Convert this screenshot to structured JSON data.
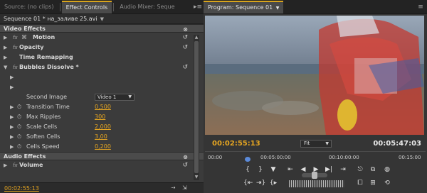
{
  "left_panel": {
    "tabs": [
      "Source: (no clips)",
      "Effect Controls",
      "Audio Mixer: Seque"
    ],
    "tab_menu_icon": "panel-menu-icon",
    "sequence_label": "Sequence 01 * на_заливе 25.avi",
    "video_section": "Video Effects",
    "effects": {
      "motion": "Motion",
      "opacity": "Opacity",
      "time_remapping": "Time Remapping",
      "bubbles": "Bubbles Dissolve *"
    },
    "fx_label": "fx",
    "params": {
      "second_image_label": "Second Image",
      "second_image_value": "Video 1",
      "transition_time_label": "Transition Time",
      "transition_time_value": "0,500",
      "max_ripples_label": "Max Ripples",
      "max_ripples_value": "300",
      "scale_cells_label": "Scale Cells",
      "scale_cells_value": "2,000",
      "soften_cells_label": "Soften Cells",
      "soften_cells_value": "3,00",
      "cells_speed_label": "Cells Speed",
      "cells_speed_value": "0,200"
    },
    "audio_section": "Audio Effects",
    "audio_effects": {
      "volume": "Volume"
    },
    "timecode": "00:02:55:13"
  },
  "right_panel": {
    "tab": "Program: Sequence 01",
    "current_timecode": "00:02:55:13",
    "zoom": "Fit",
    "duration": "00:05:47:03",
    "ruler_labels": [
      "00:00",
      "00:05:00:00",
      "00:10:00:00",
      "00:15:00"
    ]
  },
  "colors": {
    "accent": "#e5a521",
    "panel_bg": "#3b3b3b",
    "active_tab_border": "#d9a41b",
    "playhead": "#5b8ad9"
  }
}
